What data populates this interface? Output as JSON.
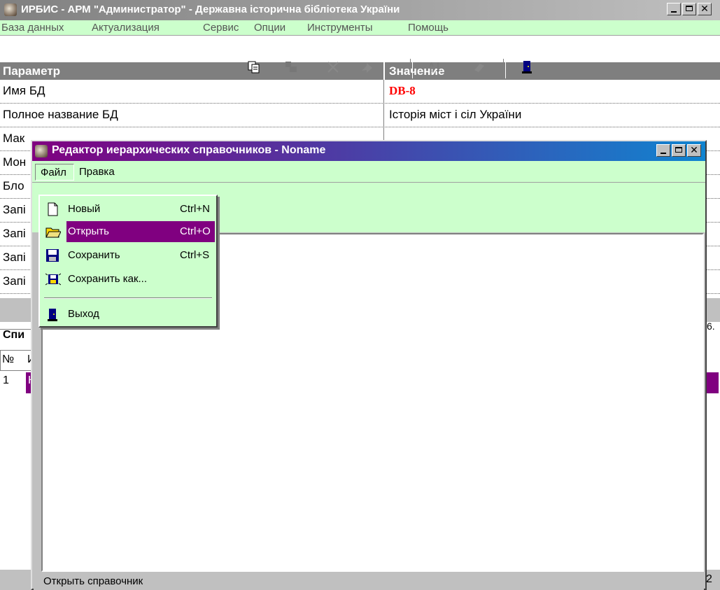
{
  "main_window": {
    "title": "ИРБИС - АРМ \"Администратор\" - Державна історична бібліотека України",
    "menu": [
      "База данных",
      "Актуализация",
      "Сервис",
      "Опции",
      "Инструменты",
      "Помощь"
    ]
  },
  "params": {
    "header_param": "Параметр",
    "header_value": "Значение",
    "rows": [
      {
        "name": "Имя БД",
        "value": "DB-8"
      },
      {
        "name": "Полное название БД",
        "value": "Історія міст і сіл України"
      },
      {
        "name": "Мак",
        "value": ""
      },
      {
        "name": "Мон",
        "value": ""
      },
      {
        "name": "Бло",
        "value": ""
      },
      {
        "name": "Запі",
        "value": ""
      },
      {
        "name": "Запі",
        "value": ""
      },
      {
        "name": "Запі",
        "value": ""
      },
      {
        "name": "Запі",
        "value": ""
      }
    ],
    "fragments": {
      "list_label": "Спи",
      "col_no": "№",
      "col_next": "И",
      "row_no": "1",
      "row_next": "К",
      "right_value": "6.",
      "status_right": "2"
    }
  },
  "editor": {
    "title": "Редактор иерархических справочников - Noname",
    "menu_file": "Файл",
    "menu_edit": "Правка",
    "status": "Открыть справочник",
    "toolbar_icons": [
      "copy-icon",
      "move-node-icon",
      "delete-icon",
      "arrow-icon",
      "sort-az-icon",
      "eraser-icon",
      "exit-door-icon"
    ]
  },
  "file_menu": {
    "items": [
      {
        "label": "Новый",
        "shortcut": "Ctrl+N",
        "icon": "new-document-icon"
      },
      {
        "label": "Открыть",
        "shortcut": "Ctrl+O",
        "icon": "open-folder-icon",
        "highlighted": true
      },
      {
        "label": "Сохранить",
        "shortcut": "Ctrl+S",
        "icon": "save-disk-icon"
      },
      {
        "label": "Сохранить как...",
        "shortcut": "",
        "icon": "save-as-icon"
      },
      {
        "label": "Выход",
        "shortcut": "",
        "icon": "exit-door-icon"
      }
    ]
  },
  "colors": {
    "menu_green": "#ccffcc",
    "highlight_purple": "#800080",
    "db_name_red": "#ff0000",
    "header_gray": "#7f7f7f"
  }
}
